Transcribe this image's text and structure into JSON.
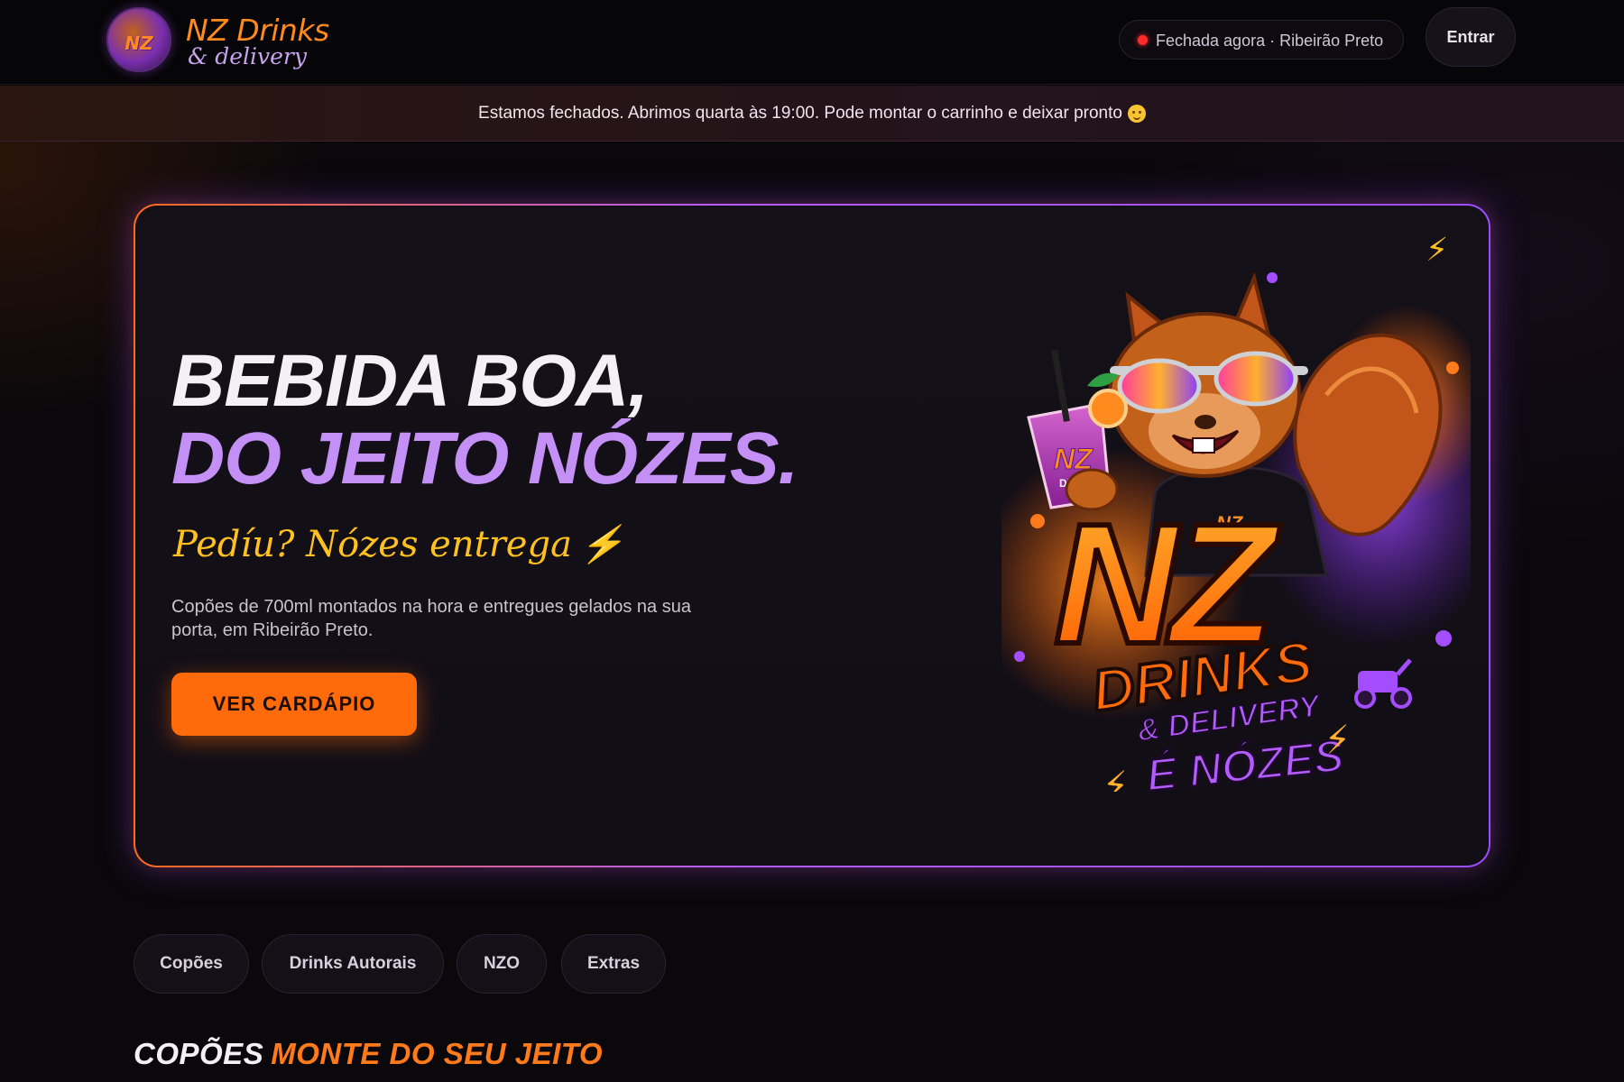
{
  "header": {
    "brand_badge_text": "NZ",
    "brand_name": "NZ Drinks",
    "brand_sub": "& delivery",
    "status_text": "Fechada agora · Ribeirão Preto",
    "login_label": "Entrar"
  },
  "banner": {
    "text": "Estamos fechados. Abrimos quarta às 19:00. Pode montar o carrinho e deixar pronto"
  },
  "hero": {
    "title_line1": "BEBIDA BOA,",
    "title_line2": "DO JEITO NÓZES.",
    "tagline": "Pedíu? Nózes entrega",
    "tagline_bolt": "⚡",
    "description": "Copões de 700ml montados na hora e entregues gelados na sua porta, em Ribeirão Preto.",
    "cta_label": "VER CARDÁPIO",
    "corner_bolt": "⚡",
    "art": {
      "logo_nz": "NZ",
      "logo_drinks": "DRINKS",
      "logo_delivery": "& DELIVERY",
      "logo_slogan": "É NÓZES",
      "cup_label": "NZ",
      "cup_sub": "DRINKS",
      "shirt_label": "NZ"
    }
  },
  "tabs": [
    {
      "label": "Copões"
    },
    {
      "label": "Drinks Autorais"
    },
    {
      "label": "NZO"
    },
    {
      "label": "Extras"
    }
  ],
  "section": {
    "title_part1": "COPÕES",
    "title_part2": "MONTE DO SEU JEITO"
  },
  "colors": {
    "accent_orange": "#ff6a0a",
    "accent_purple": "#b45bff",
    "accent_yellow": "#ffc11f",
    "status_red": "#ff2b2b"
  }
}
